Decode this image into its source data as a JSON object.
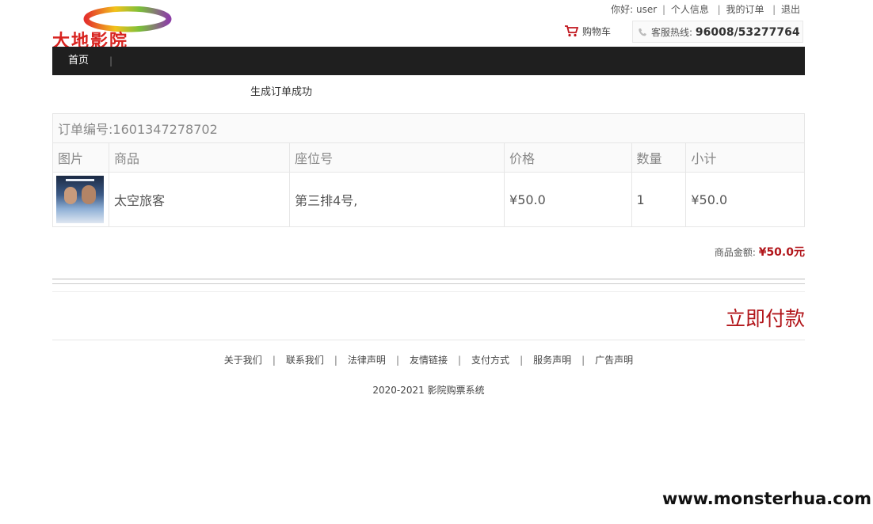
{
  "header": {
    "logo_text": "大地影院",
    "greeting_prefix": "你好:",
    "username": "user",
    "link_profile": "个人信息",
    "link_orders": "我的订单",
    "link_logout": "退出",
    "cart_label": "购物车",
    "hotline_label": "客服热线:",
    "hotline_number": "96008/53277764"
  },
  "nav": {
    "home": "首页",
    "divider": "|"
  },
  "message": "生成订单成功",
  "order": {
    "number_label": "订单编号:",
    "number": "1601347278702",
    "columns": [
      "图片",
      "商品",
      "座位号",
      "价格",
      "数量",
      "小计"
    ],
    "items": [
      {
        "title": "太空旅客",
        "seat": "第三排4号,",
        "price": "¥50.0",
        "quantity": "1",
        "subtotal": "¥50.0"
      }
    ]
  },
  "total": {
    "label": "商品金额:",
    "value": "¥50.0元"
  },
  "pay_button": "立即付款",
  "footer": {
    "links": [
      "关于我们",
      "联系我们",
      "法律声明",
      "友情链接",
      "支付方式",
      "服务声明",
      "广告声明"
    ],
    "copyright": "2020-2021 影院购票系统"
  },
  "watermark": "www.monsterhua.com",
  "colors": {
    "accent": "#b2171c",
    "nav_bg": "#1f1f1f",
    "logo_red": "#d8231f"
  }
}
